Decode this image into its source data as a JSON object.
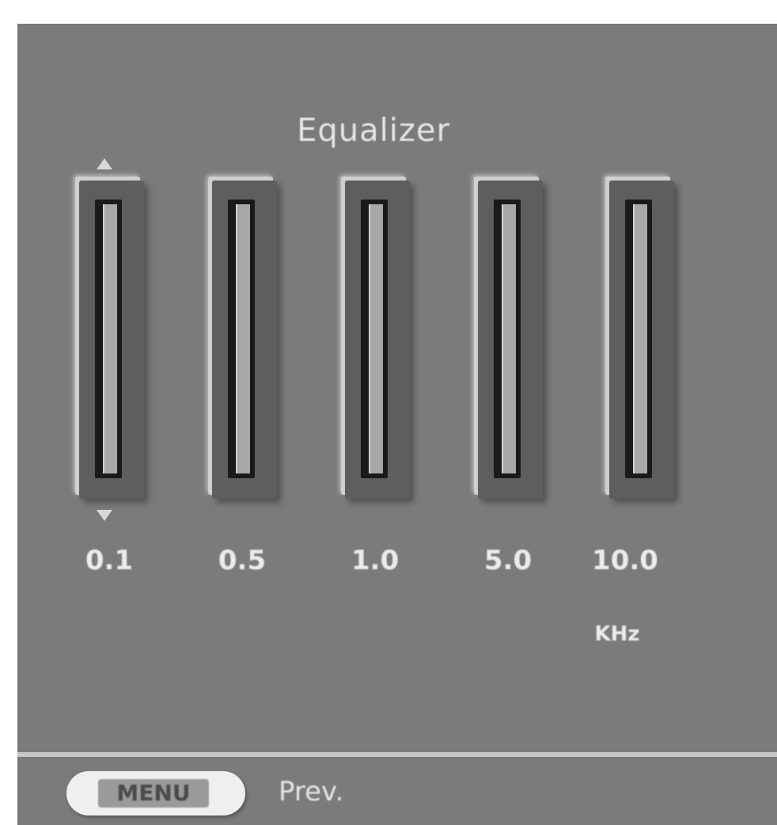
{
  "equalizer": {
    "title": "Equalizer",
    "bands": [
      {
        "label": "0.1"
      },
      {
        "label": "0.5"
      },
      {
        "label": "1.0"
      },
      {
        "label": "5.0"
      },
      {
        "label": "10.0"
      }
    ],
    "unit": "KHz"
  },
  "footer": {
    "key_label": "MENU",
    "action_label": "Prev."
  },
  "colors": {
    "background": "#7b7b7b",
    "text": "#e4e4e4"
  },
  "icons": {
    "up": "arrow-up-icon",
    "down": "arrow-down-icon"
  }
}
